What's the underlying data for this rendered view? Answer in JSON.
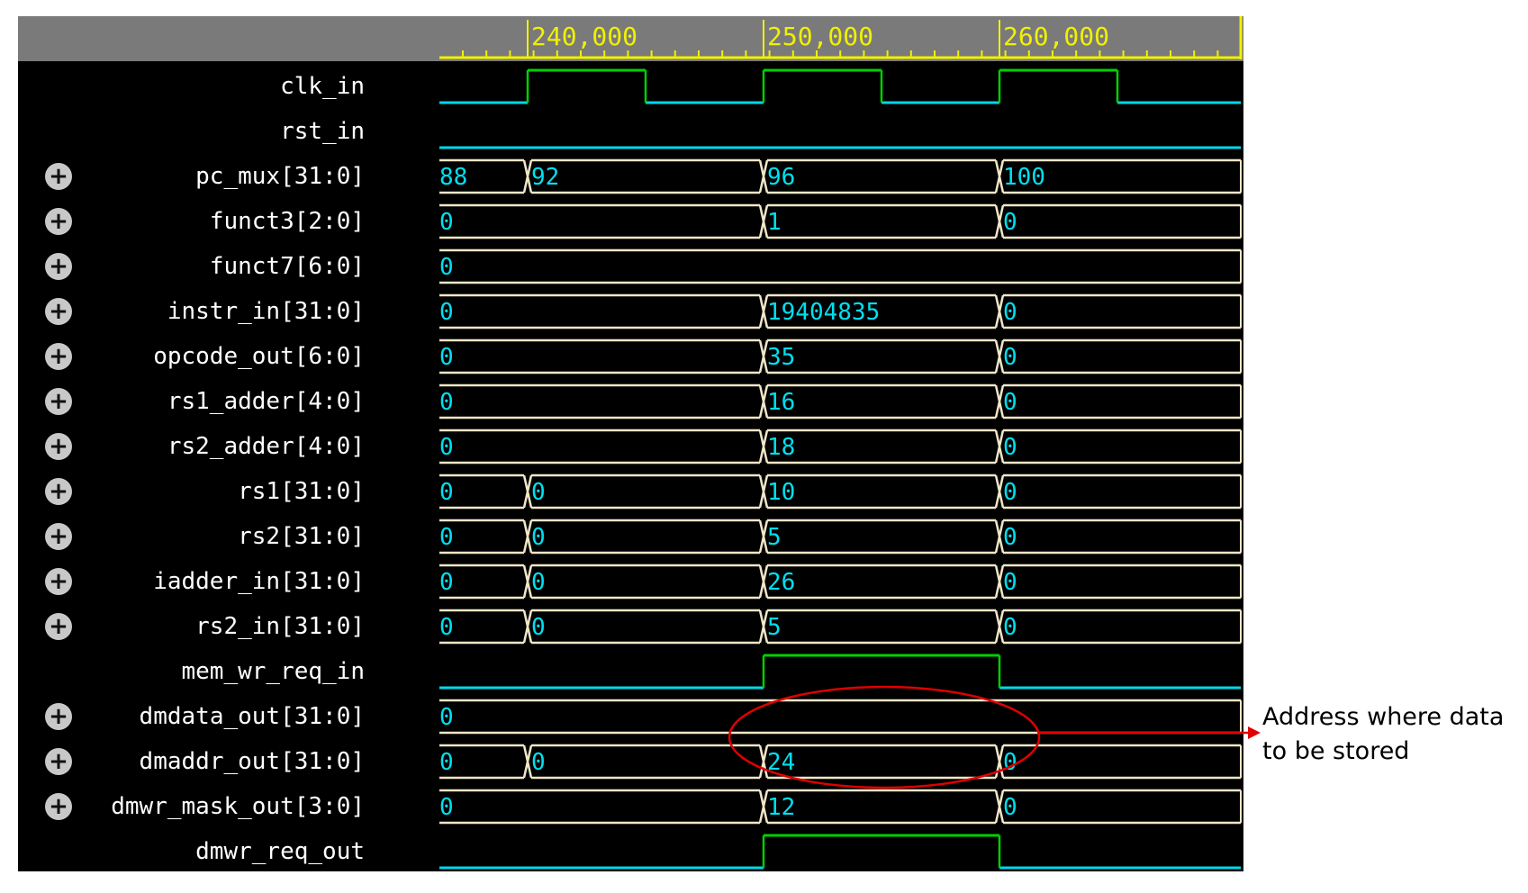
{
  "timeline": {
    "ticks": [
      "240,000",
      "250,000",
      "260,000"
    ]
  },
  "signals": [
    {
      "name": "clk_in",
      "kind": "clock",
      "expandable": false
    },
    {
      "name": "rst_in",
      "kind": "bit",
      "expandable": false
    },
    {
      "name": "pc_mux[31:0]",
      "kind": "bus",
      "expandable": true,
      "values": [
        "88",
        "92",
        "96",
        "100"
      ]
    },
    {
      "name": "funct3[2:0]",
      "kind": "bus",
      "expandable": true,
      "values": [
        "0",
        "1",
        "0"
      ]
    },
    {
      "name": "funct7[6:0]",
      "kind": "bus",
      "expandable": true,
      "values": [
        "0"
      ]
    },
    {
      "name": "instr_in[31:0]",
      "kind": "bus",
      "expandable": true,
      "values": [
        "0",
        "19404835",
        "0"
      ]
    },
    {
      "name": "opcode_out[6:0]",
      "kind": "bus",
      "expandable": true,
      "values": [
        "0",
        "35",
        "0"
      ]
    },
    {
      "name": "rs1_adder[4:0]",
      "kind": "bus",
      "expandable": true,
      "values": [
        "0",
        "16",
        "0"
      ]
    },
    {
      "name": "rs2_adder[4:0]",
      "kind": "bus",
      "expandable": true,
      "values": [
        "0",
        "18",
        "0"
      ]
    },
    {
      "name": "rs1[31:0]",
      "kind": "bus",
      "expandable": true,
      "values": [
        "0",
        "0",
        "10",
        "0"
      ]
    },
    {
      "name": "rs2[31:0]",
      "kind": "bus",
      "expandable": true,
      "values": [
        "0",
        "0",
        "5",
        "0"
      ]
    },
    {
      "name": "iadder_in[31:0]",
      "kind": "bus",
      "expandable": true,
      "values": [
        "0",
        "0",
        "26",
        "0"
      ]
    },
    {
      "name": "rs2_in[31:0]",
      "kind": "bus",
      "expandable": true,
      "values": [
        "0",
        "0",
        "5",
        "0"
      ]
    },
    {
      "name": "mem_wr_req_in",
      "kind": "pulse",
      "expandable": false
    },
    {
      "name": "dmdata_out[31:0]",
      "kind": "bus",
      "expandable": true,
      "values": [
        "0"
      ]
    },
    {
      "name": "dmaddr_out[31:0]",
      "kind": "bus",
      "expandable": true,
      "values": [
        "0",
        "0",
        "24",
        "0"
      ]
    },
    {
      "name": "dmwr_mask_out[3:0]",
      "kind": "bus",
      "expandable": true,
      "values": [
        "0",
        "12",
        "0"
      ]
    },
    {
      "name": "dmwr_req_out",
      "kind": "pulse",
      "expandable": false
    }
  ],
  "annotation": {
    "line1": "Address where data",
    "line2": "to be stored"
  },
  "colors": {
    "bus_line": "#f0e6c8",
    "high": "#00d000",
    "low": "#00d8e8",
    "value_text": "#00e0f0",
    "timeline": "#f0f000",
    "highlight": "#e00000"
  },
  "icons": {
    "expand": "plus-circle-icon"
  }
}
